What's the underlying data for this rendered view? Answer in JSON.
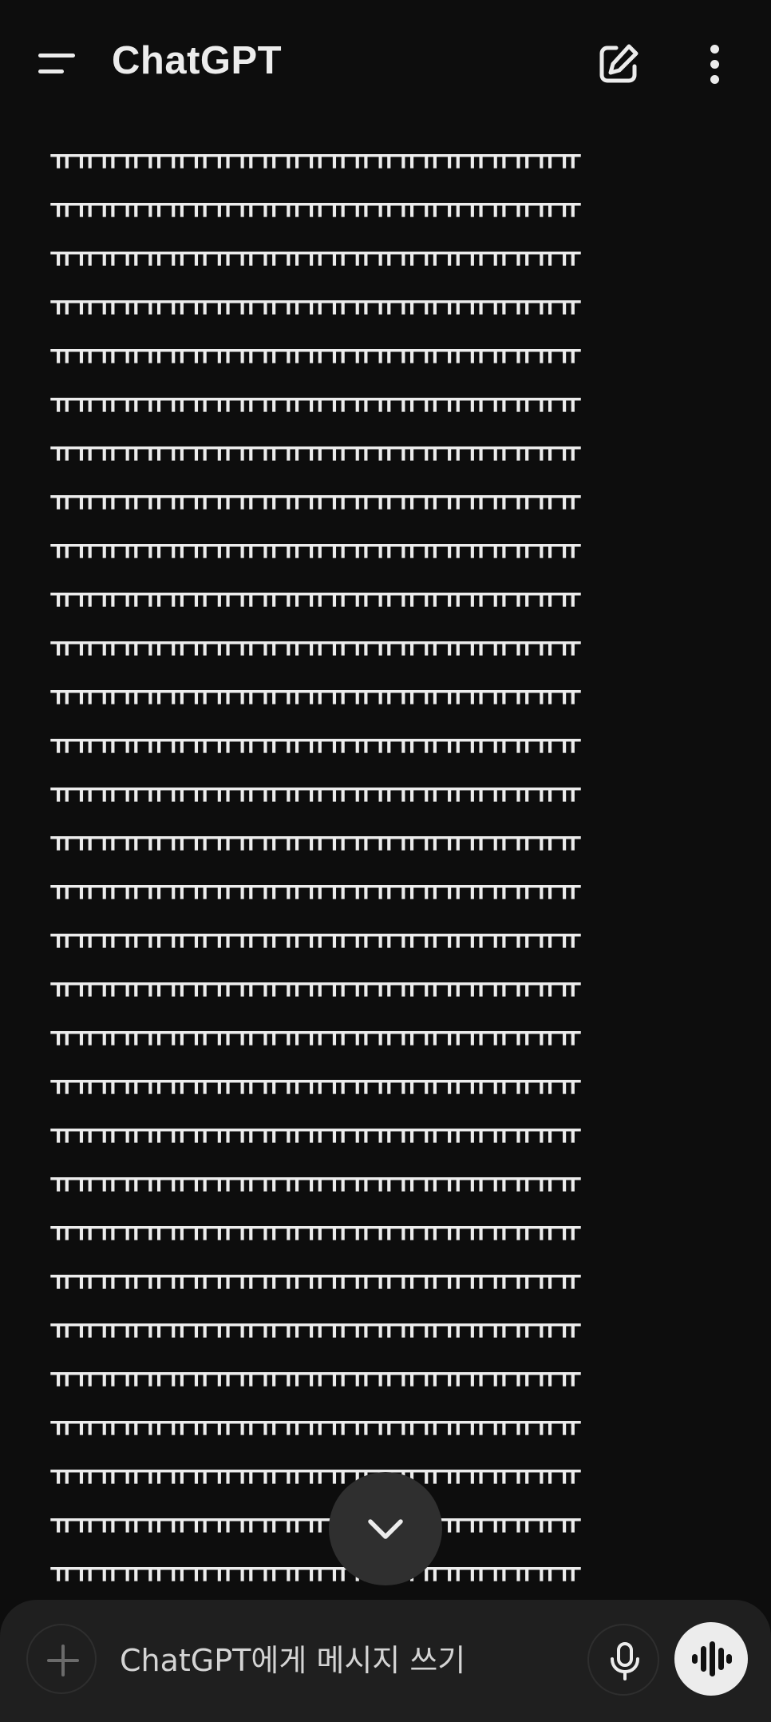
{
  "header": {
    "title": "ChatGPT",
    "menu_icon": "hamburger-menu-icon",
    "new_chat_icon": "edit-square-icon",
    "more_icon": "more-vertical-icon"
  },
  "conversation": {
    "message_line": "ㅠㅠㅠㅠㅠㅠㅠㅠㅠㅠㅠㅠㅠㅠㅠㅠㅠㅠㅠㅠㅠㅠㅠ",
    "visible_line_count": 30
  },
  "scroll_down": {
    "icon": "chevron-down-icon"
  },
  "composer": {
    "placeholder": "ChatGPT에게 메시지 쓰기",
    "value": "",
    "attach_icon": "plus-icon",
    "mic_icon": "microphone-icon",
    "voice_icon": "voice-waveform-icon"
  },
  "colors": {
    "background": "#0d0d0d",
    "composer_bg": "#1f1f1f",
    "text": "#ececec",
    "scroll_button_bg": "#2f2f2f",
    "voice_button_bg": "#ececec"
  }
}
